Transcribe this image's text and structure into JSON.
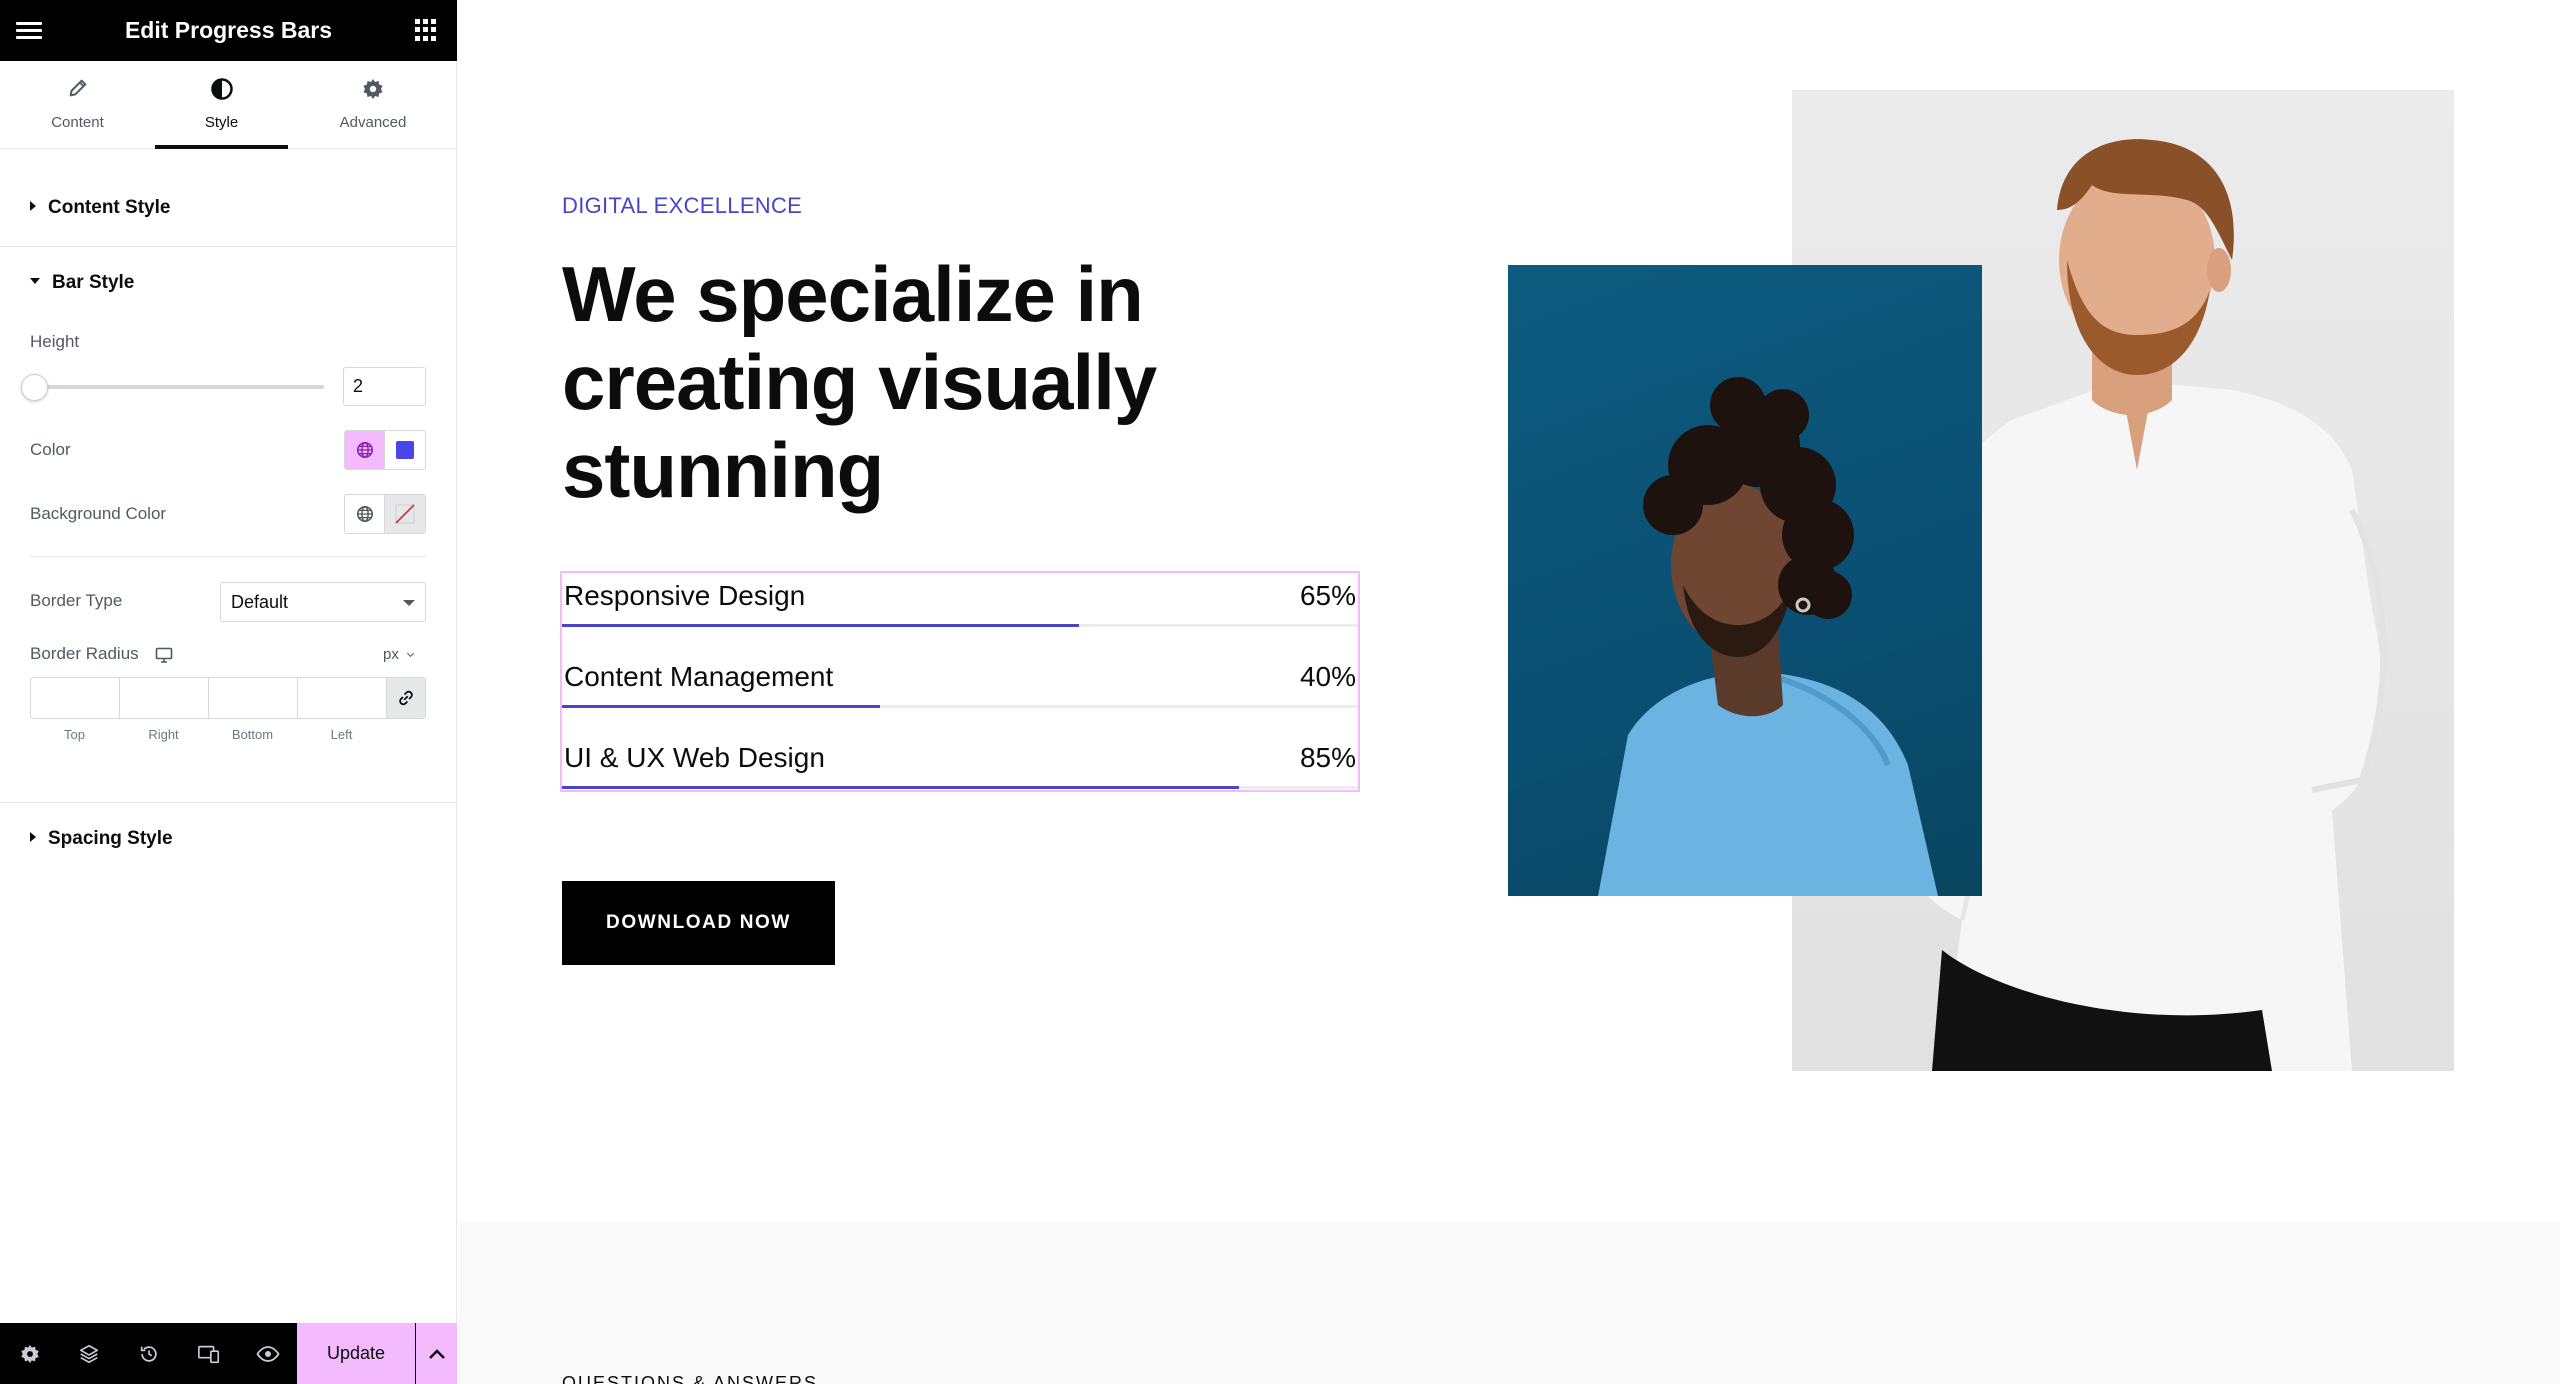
{
  "panel": {
    "title": "Edit Progress Bars",
    "tabs": [
      {
        "label": "Content",
        "icon": "pencil-icon"
      },
      {
        "label": "Style",
        "icon": "contrast-icon"
      },
      {
        "label": "Advanced",
        "icon": "gear-icon"
      }
    ],
    "active_tab": "Style",
    "sections": {
      "content_style": "Content Style",
      "bar_style": "Bar Style",
      "spacing_style": "Spacing Style"
    },
    "controls": {
      "height_label": "Height",
      "height_value": "2",
      "height_slider_fraction": 0.0,
      "color_label": "Color",
      "color_value": "#4a45e8",
      "bg_color_label": "Background Color",
      "border_type_label": "Border Type",
      "border_type_value": "Default",
      "border_radius_label": "Border Radius",
      "border_radius_unit": "px",
      "dimension_labels": [
        "Top",
        "Right",
        "Bottom",
        "Left"
      ]
    },
    "footer": {
      "update_label": "Update"
    }
  },
  "page": {
    "kicker": "DIGITAL EXCELLENCE",
    "headline": "We specialize in creating visually stunning",
    "progress_bars": [
      {
        "name": "Responsive Design",
        "percent_label": "65%",
        "value": 65
      },
      {
        "name": "Content Management",
        "percent_label": "40%",
        "value": 40
      },
      {
        "name": "UI & UX Web Design",
        "percent_label": "85%",
        "value": 85
      }
    ],
    "cta_label": "DOWNLOAD NOW",
    "faq_label": "QUESTIONS & ANSWERS",
    "colors": {
      "accent": "#4a45c7",
      "selection_outline": "#f3bafd",
      "photo_blue": "#0d5b80",
      "photo_grey": "#e6e6e6"
    }
  }
}
